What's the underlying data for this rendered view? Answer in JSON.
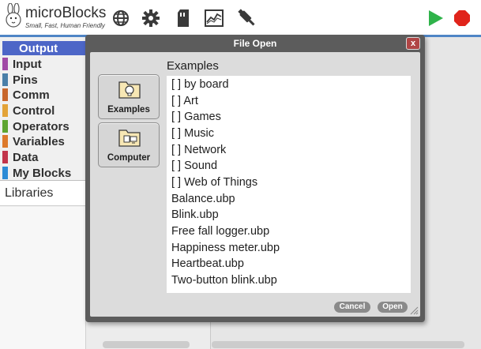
{
  "app": {
    "brand": "microBlocks",
    "tagline": "Small, Fast, Human Friendly"
  },
  "toolbar": {
    "icons": [
      "globe-icon",
      "gear-icon",
      "file-icon",
      "graph-icon",
      "usb-icon",
      "start-icon",
      "stop-icon"
    ],
    "colors": {
      "start": "#2fb34a",
      "stop": "#e0241b"
    }
  },
  "palette": {
    "categories": [
      {
        "label": "Output",
        "color": "#4d66c7"
      },
      {
        "label": "Input",
        "color": "#a14aa6"
      },
      {
        "label": "Pins",
        "color": "#4a7fa8"
      },
      {
        "label": "Comm",
        "color": "#c8672c"
      },
      {
        "label": "Control",
        "color": "#e3a338"
      },
      {
        "label": "Operators",
        "color": "#5fa531"
      },
      {
        "label": "Variables",
        "color": "#dd7a2b"
      },
      {
        "label": "Data",
        "color": "#c2344a"
      },
      {
        "label": "My Blocks",
        "color": "#2c8bd6"
      }
    ],
    "libraries_label": "Libraries"
  },
  "dialog": {
    "title": "File Open",
    "close_label": "x",
    "sources": [
      {
        "label": "Examples",
        "icon": "lightbulb-folder-icon"
      },
      {
        "label": "Computer",
        "icon": "computer-folder-icon"
      }
    ],
    "folder_heading": "Examples",
    "files": [
      "[ ]  by board",
      "[ ] Art",
      "[ ] Games",
      "[ ] Music",
      "[ ] Network",
      "[ ] Sound",
      "[ ] Web of Things",
      "Balance.ubp",
      "Blink.ubp",
      "Free fall logger.ubp",
      "Happiness meter.ubp",
      "Heartbeat.ubp",
      "Two-button blink.ubp"
    ],
    "cancel_label": "Cancel",
    "open_label": "Open"
  }
}
